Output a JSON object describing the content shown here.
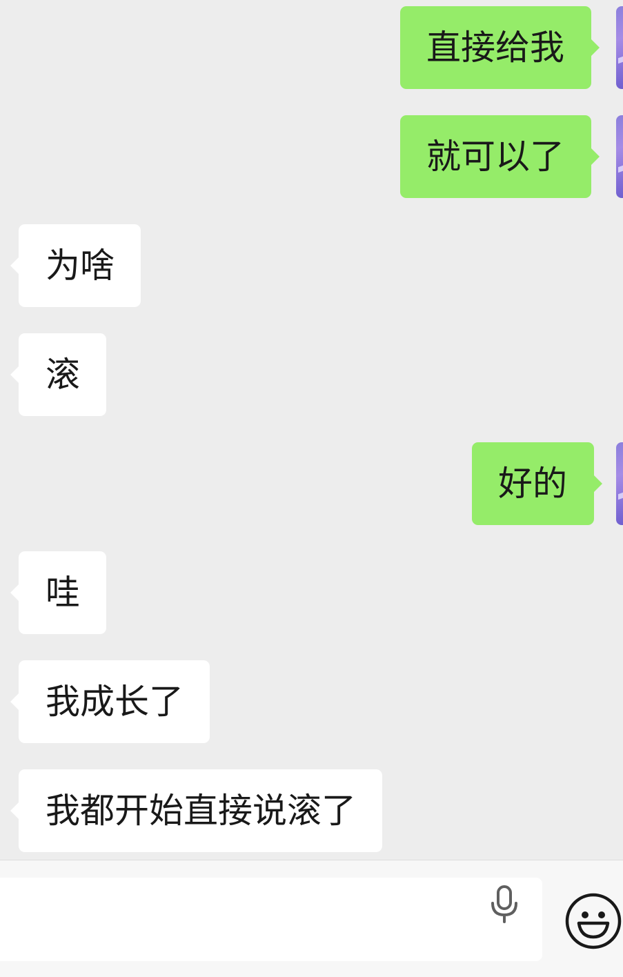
{
  "messages": [
    {
      "side": "sent",
      "text": "直接给我"
    },
    {
      "side": "sent",
      "text": "就可以了"
    },
    {
      "side": "received",
      "text": "为啥"
    },
    {
      "side": "received",
      "text": "滚"
    },
    {
      "side": "sent",
      "text": "好的"
    },
    {
      "side": "received",
      "text": "哇"
    },
    {
      "side": "received",
      "text": "我成长了"
    },
    {
      "side": "received",
      "text": "我都开始直接说滚了"
    }
  ],
  "input_bar": {
    "text": "",
    "voice_icon": "microphone-icon",
    "emoji_icon": "smiley-emoji-icon"
  },
  "colors": {
    "background": "#ededed",
    "sent_bubble": "#95ec69",
    "received_bubble": "#ffffff",
    "text": "#191919"
  }
}
